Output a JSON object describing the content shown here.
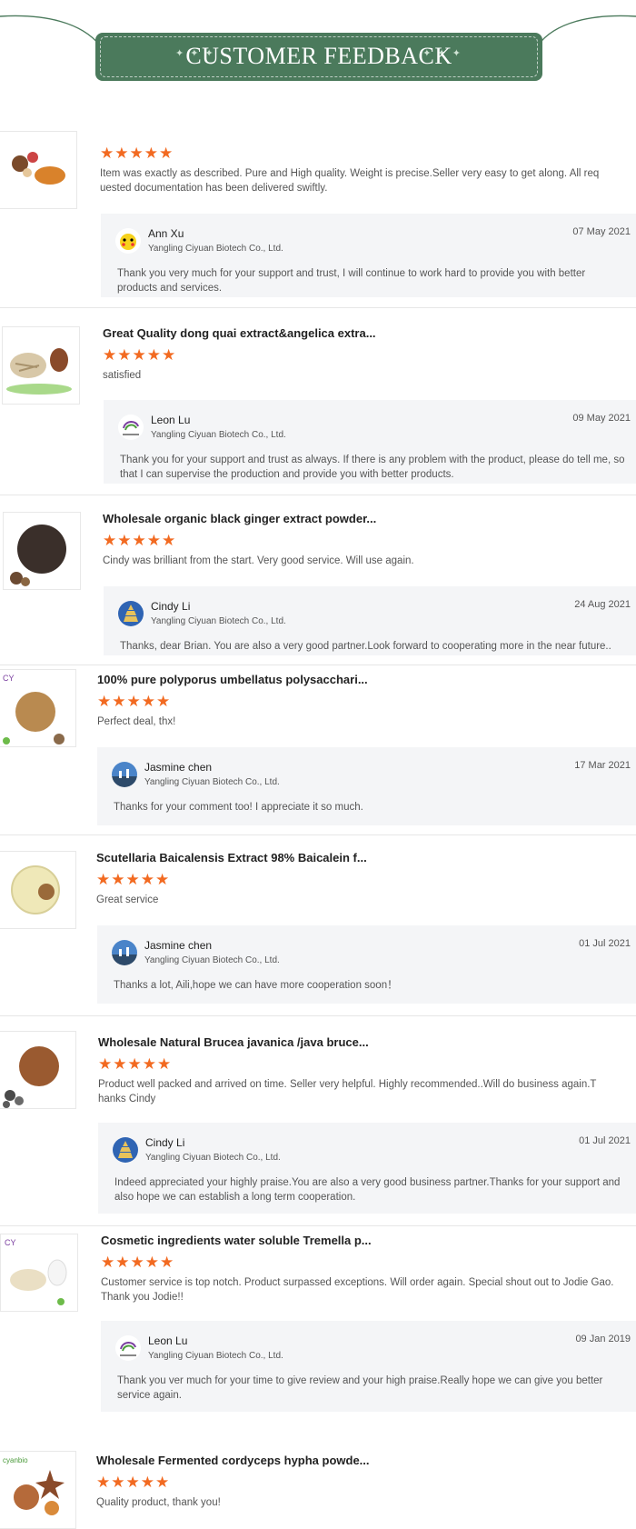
{
  "header": {
    "title": "CUSTOMER FEEDBACK"
  },
  "colors": {
    "banner": "#4b7a5c",
    "star": "#f26a21",
    "reply_bg": "#f4f5f7"
  },
  "stars": "★★★★★",
  "company": "Yangling Ciyuan Biotech Co., Ltd.",
  "reviews": [
    {
      "title": "",
      "comment": "Item was exactly as described. Pure and High quality. Weight is precise.Seller very easy to get along. All req uested documentation has been delivered swiftly.",
      "reply_name": "Ann Xu",
      "reply_date": "07 May 2021",
      "reply_avatar": "pikachu-avatar",
      "reply_text": "Thank you  very much for your support and trust, I will continue to work hard to provide you with better products and services."
    },
    {
      "title": "Great Quality dong quai extract&angelica extra...",
      "comment": "satisfied",
      "reply_name": "Leon Lu",
      "reply_date": "09 May 2021",
      "reply_avatar": "company-logo-avatar",
      "reply_text": "Thank you for your support and trust as always. If there is any problem with the product, please do tell me, so that I can supervise the production and provide you with better products."
    },
    {
      "title": "Wholesale organic black ginger extract powder...",
      "comment": "Cindy was brilliant from the start. Very good service. Will use again.",
      "reply_name": "Cindy Li",
      "reply_date": "24 Aug 2021",
      "reply_avatar": "pagoda-avatar",
      "reply_text": "Thanks, dear Brian. You are also a very good partner.Look forward to cooperating more in the near future.."
    },
    {
      "title": "100% pure polyporus umbellatus polysacchari...",
      "comment": "Perfect deal, thx!",
      "reply_name": "Jasmine chen",
      "reply_date": "17 Mar 2021",
      "reply_avatar": "landscape-avatar",
      "reply_text": "Thanks for your comment too! I appreciate it so much."
    },
    {
      "title": "Scutellaria Baicalensis Extract 98% Baicalein f...",
      "comment": "Great service",
      "reply_name": "Jasmine chen",
      "reply_date": "01 Jul 2021",
      "reply_avatar": "landscape-avatar",
      "reply_text": "Thanks a lot, Aili,hope we can have more cooperation soon！"
    },
    {
      "title": "Wholesale Natural Brucea javanica /java bruce...",
      "comment": "Product well packed and arrived on time. Seller very helpful. Highly recommended..Will do business again.T hanks Cindy",
      "reply_name": "Cindy Li",
      "reply_date": "01 Jul 2021",
      "reply_avatar": "pagoda-avatar",
      "reply_text": "Indeed appreciated your highly praise.You are also a very good business partner.Thanks for your support and also hope we can establish a long term cooperation."
    },
    {
      "title": "Cosmetic ingredients water soluble Tremella p...",
      "comment": "Customer service is top notch. Product surpassed exceptions. Will order again. Special shout out to Jodie Gao. Thank you Jodie!!",
      "reply_name": "Leon Lu",
      "reply_date": "09 Jan 2019",
      "reply_avatar": "company-logo-avatar",
      "reply_text": "Thank you ver much for your time to give review and your high praise.Really hope we can give you better service again."
    },
    {
      "title": "Wholesale Fermented cordyceps hypha powde...",
      "comment": "Quality product, thank you!"
    }
  ]
}
